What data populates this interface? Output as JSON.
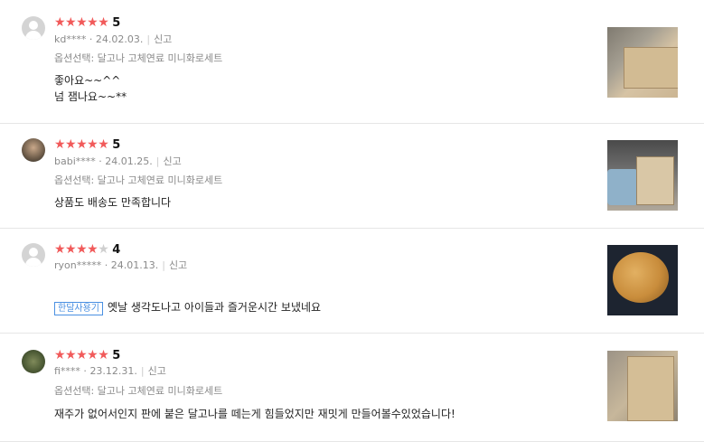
{
  "reviews": [
    {
      "stars": "★★★★★",
      "stars_off": "",
      "score": "5",
      "user": "kd****",
      "date": "24.02.03.",
      "report": "신고",
      "option": "옵션선택: 달고나 고체연료 미니화로세트",
      "badge": "",
      "text_lines": [
        "좋아요~~^^",
        "넘 잼나요~~**"
      ]
    },
    {
      "stars": "★★★★★",
      "stars_off": "",
      "score": "5",
      "user": "babi****",
      "date": "24.01.25.",
      "report": "신고",
      "option": "옵션선택: 달고나 고체연료 미니화로세트",
      "badge": "",
      "text_lines": [
        "상품도 배송도 만족합니다"
      ]
    },
    {
      "stars": "★★★★",
      "stars_off": "★",
      "score": "4",
      "user": "ryon*****",
      "date": "24.01.13.",
      "report": "신고",
      "option": "",
      "badge": "한달사용기",
      "text_lines": [
        "옛날 생각도나고 아이들과 즐거운시간 보냈네요"
      ]
    },
    {
      "stars": "★★★★★",
      "stars_off": "",
      "score": "5",
      "user": "fi****",
      "date": "23.12.31.",
      "report": "신고",
      "option": "옵션선택: 달고나 고체연료 미니화로세트",
      "badge": "",
      "text_lines": [
        "재주가 없어서인지 판에 붙은 달고나를 떼는게 힘들었지만 재밋게 만들어볼수있었습니다!"
      ]
    }
  ],
  "colors": {
    "star": "#f15a5a",
    "star_off": "#cfcfcf",
    "badge": "#4a90e2"
  },
  "icons": {
    "avatar_default": "user-silhouette-icon"
  }
}
